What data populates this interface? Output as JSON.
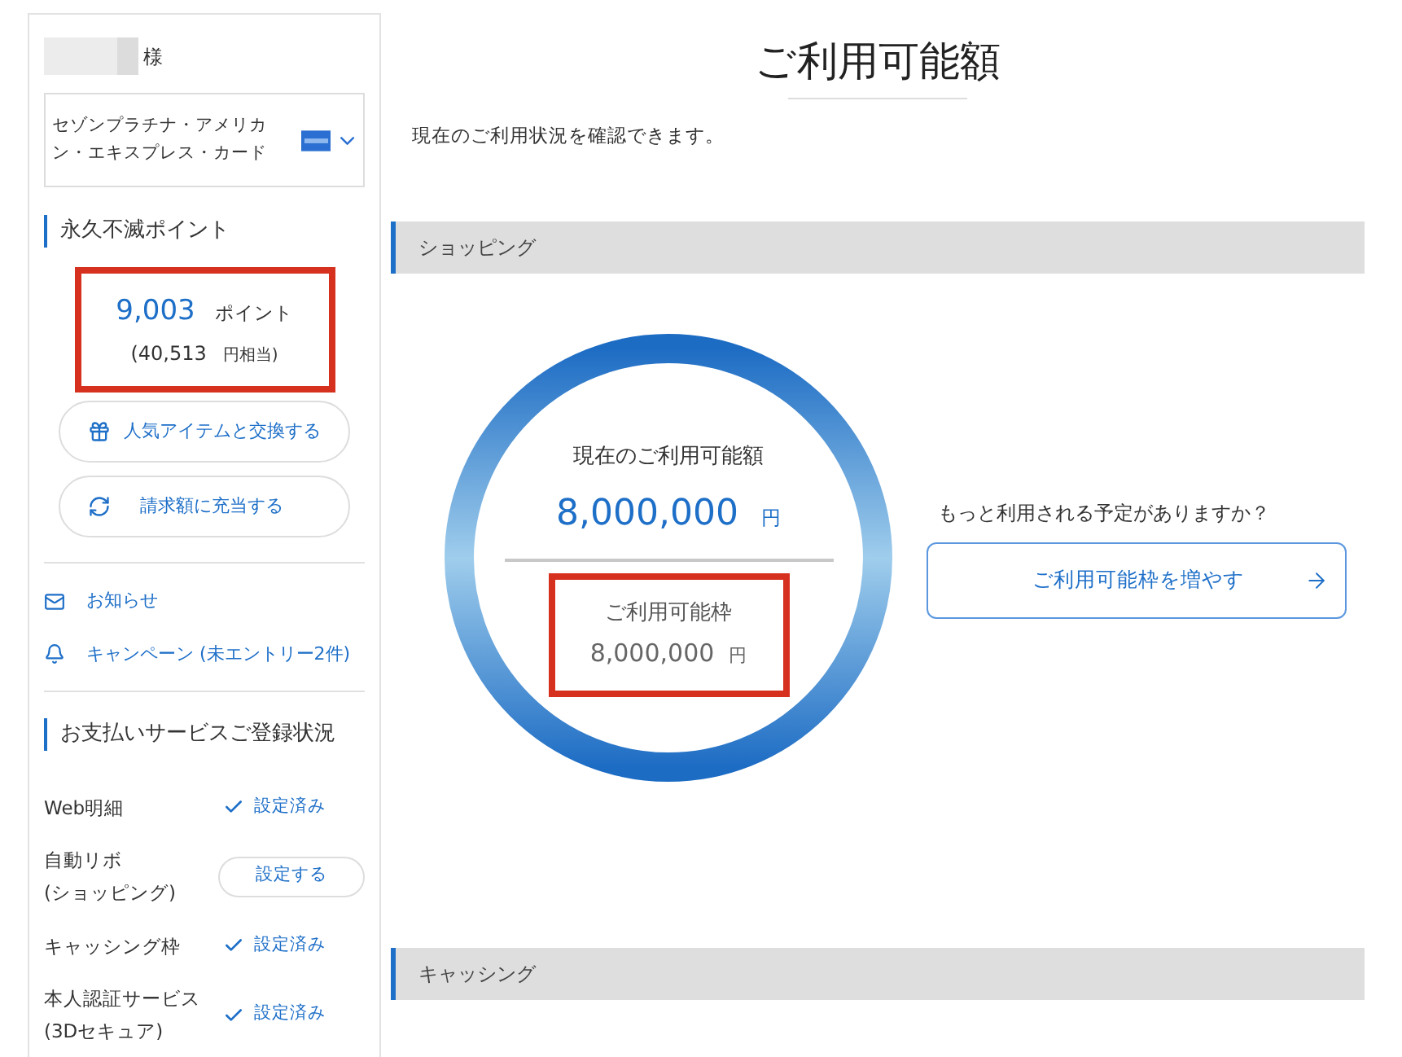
{
  "sidebar": {
    "name_suffix": "様",
    "card": {
      "name": "セゾンプラチナ・アメリカン・エキスプレス・カード"
    },
    "points": {
      "heading": "永久不滅ポイント",
      "value": "9,003",
      "unit": "ポイント",
      "yen_prefix": "(40,513",
      "yen_suffix": "円相当)",
      "highlighted": true
    },
    "point_buttons": [
      {
        "kind": "gift",
        "label": "人気アイテムと交換する"
      },
      {
        "kind": "refresh",
        "label": "請求額に充当する"
      }
    ],
    "links": [
      {
        "kind": "mail",
        "label": "お知らせ"
      },
      {
        "kind": "bell",
        "label": "キャンペーン (未エントリー2件)"
      }
    ],
    "services": {
      "heading": "お支払いサービスご登録状況",
      "rows": [
        {
          "label": "Web明細",
          "kind": "done",
          "status": "設定済み"
        },
        {
          "label": "自動リボ\n(ショッピング)",
          "kind": "button",
          "status": "設定する"
        },
        {
          "label": "キャッシング枠",
          "kind": "done",
          "status": "設定済み"
        },
        {
          "label": "本人認証サービス\n(3Dセキュア)",
          "kind": "done",
          "status": "設定済み"
        }
      ]
    }
  },
  "main": {
    "title": "ご利用可能額",
    "description": "現在のご利用状況を確認できます。",
    "sections": [
      {
        "title": "ショッピング",
        "current_label": "現在のご利用可能額",
        "current_amount": "8,000,000",
        "current_unit": "円",
        "limit_label": "ご利用可能枠",
        "limit_amount": "8,000,000",
        "limit_unit": "円",
        "limit_highlighted": true,
        "question": "もっと利用される予定がありますか？",
        "action": "ご利用可能枠を増やす"
      },
      {
        "title": "キャッシング"
      }
    ]
  }
}
